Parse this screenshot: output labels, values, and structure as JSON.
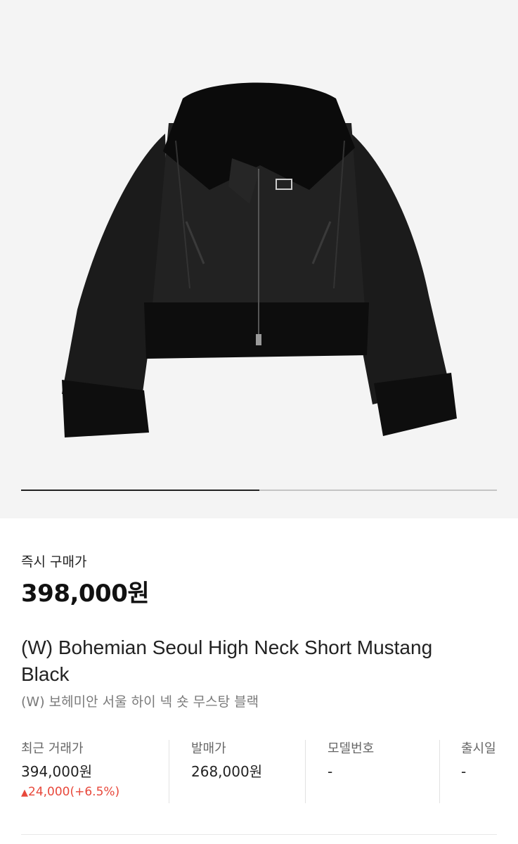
{
  "gallery": {
    "image_alt": "jacket-product-image",
    "progress": 0.5
  },
  "buy_now": {
    "label": "즉시 구매가",
    "price": "398,000원"
  },
  "product": {
    "name_en": "(W) Bohemian Seoul High Neck Short Mustang Black",
    "name_ko": "(W) 보헤미안 서울 하이 넥 숏 무스탕 블랙"
  },
  "info": {
    "recent": {
      "label": "최근 거래가",
      "value": "394,000원",
      "change_icon": "▲",
      "change": "24,000(+6.5%)",
      "change_color": "#e8483b"
    },
    "release_price": {
      "label": "발매가",
      "value": "268,000원"
    },
    "model": {
      "label": "모델번호",
      "value": "-"
    },
    "release_date": {
      "label": "출시일",
      "value": "-"
    }
  }
}
